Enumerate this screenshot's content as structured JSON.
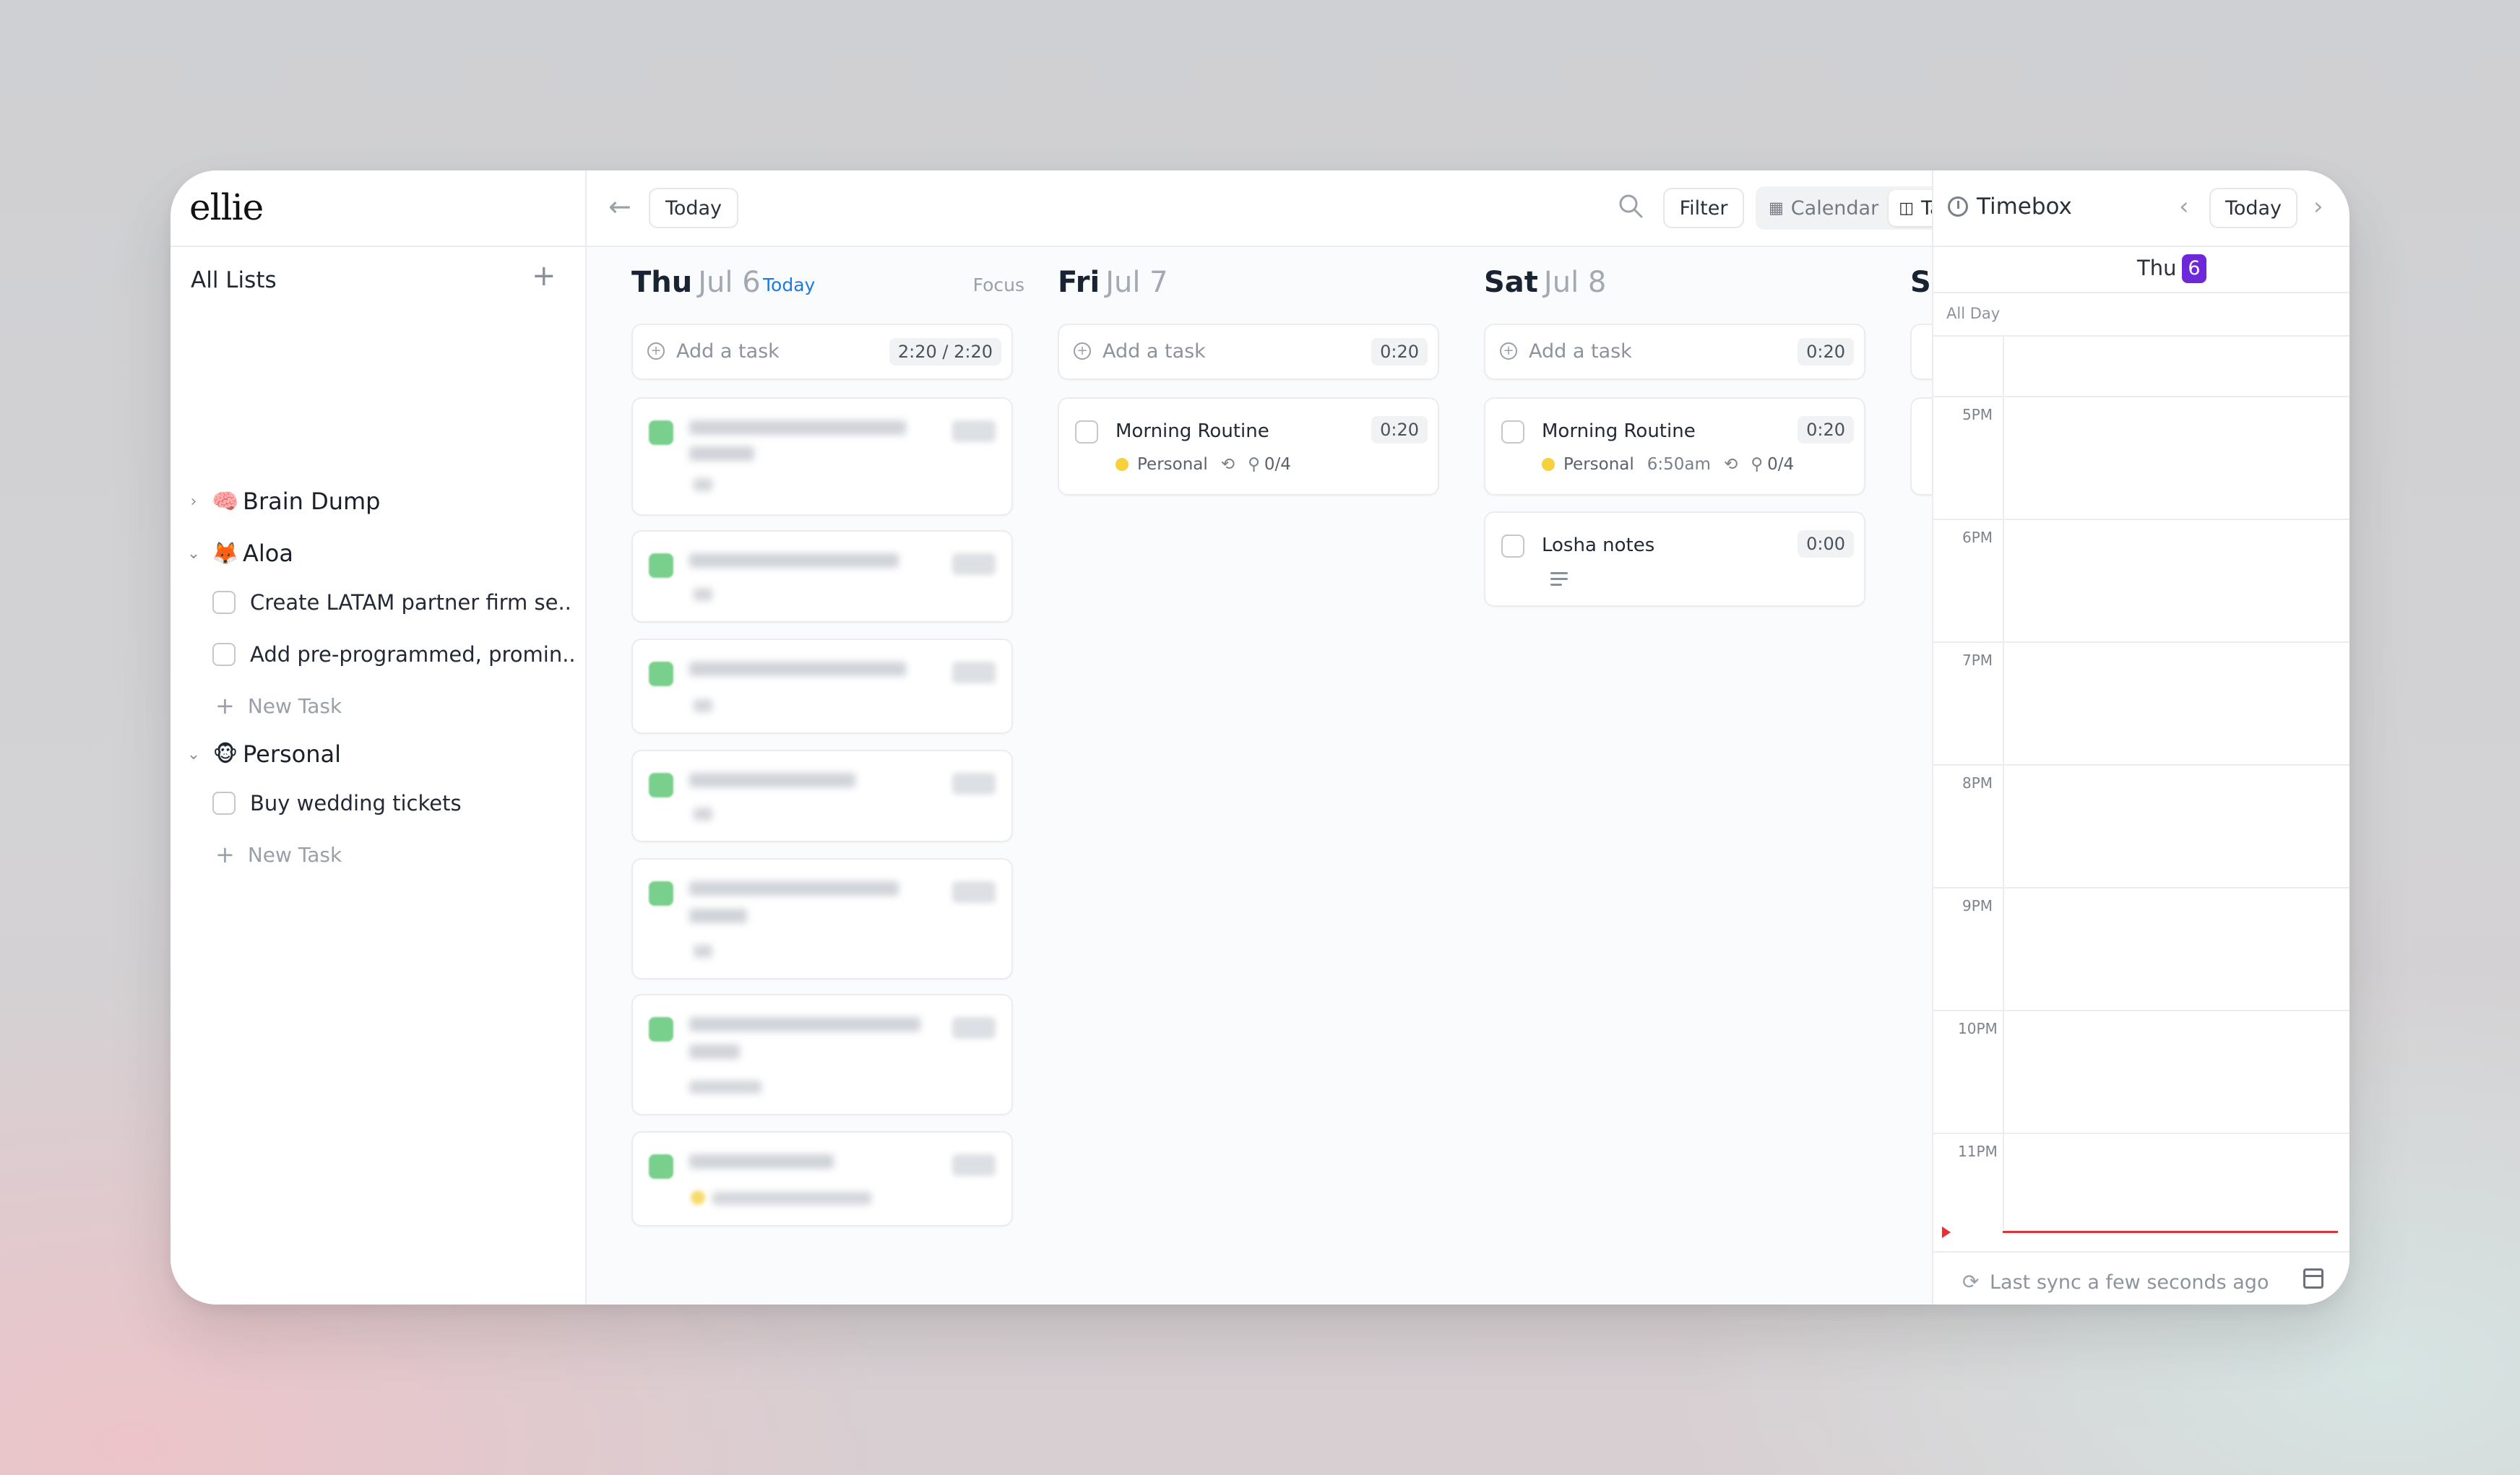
{
  "app": {
    "logo": "ellie"
  },
  "sidebar": {
    "title": "All Lists",
    "add_icon": "plus-icon",
    "lists": [
      {
        "emoji": "🧠",
        "name": "Brain Dump",
        "expanded": false,
        "tasks": []
      },
      {
        "emoji": "🦊",
        "name": "Aloa",
        "expanded": true,
        "tasks": [
          "Create LATAM partner firm se...",
          "Add pre-programmed, promin..."
        ],
        "new_task": "New Task"
      },
      {
        "emoji": "🐵",
        "name": "Personal",
        "expanded": true,
        "tasks": [
          "Buy wedding tickets"
        ],
        "new_task": "New Task"
      }
    ]
  },
  "toolbar": {
    "back_icon": "arrow-left-icon",
    "today_label": "Today",
    "search_icon": "search-icon",
    "filter_label": "Filter",
    "view_options": [
      {
        "label": "Calendar",
        "icon": "calendar-icon",
        "active": false
      },
      {
        "label": "Tasks",
        "icon": "tasks-icon",
        "active": true
      }
    ],
    "forward_icon": "arrow-right-icon"
  },
  "days": [
    {
      "dow": "Thu",
      "date": "Jul 6",
      "today_tag": "Today",
      "focus": "Focus",
      "add_task": "Add a task",
      "time": "2:20 / 2:20"
    },
    {
      "dow": "Fri",
      "date": "Jul 7",
      "add_task": "Add a task",
      "time": "0:20",
      "tasks": [
        {
          "title": "Morning Routine",
          "time": "0:20",
          "list": "Personal",
          "subtasks": "0/4"
        }
      ]
    },
    {
      "dow": "Sat",
      "date": "Jul 8",
      "add_task": "Add a task",
      "time": "0:20",
      "tasks": [
        {
          "title": "Morning Routine",
          "time": "0:20",
          "list": "Personal",
          "start": "6:50am",
          "subtasks": "0/4"
        },
        {
          "title": "Losha notes",
          "time": "0:00"
        }
      ]
    },
    {
      "dow": "Su"
    }
  ],
  "timebox": {
    "title": "Timebox",
    "today_label": "Today",
    "day": "Thu",
    "date_badge": "6",
    "all_day": "All Day",
    "hours": [
      "5PM",
      "6PM",
      "7PM",
      "8PM",
      "9PM",
      "10PM",
      "11PM"
    ],
    "sync": "Last sync a few seconds ago",
    "colors": {
      "badge": "#6d28d9",
      "now_line": "#e0323b",
      "today_link": "#1f7ae0"
    }
  }
}
